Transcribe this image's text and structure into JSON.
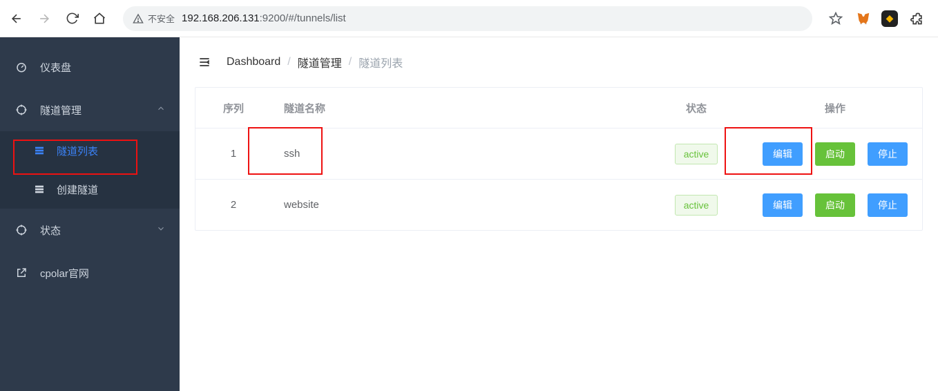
{
  "browser": {
    "insecure_label": "不安全",
    "url_host": "192.168.206.131",
    "url_port_path": ":9200/#/tunnels/list"
  },
  "sidebar": {
    "dashboard": "仪表盘",
    "tunnel_mgmt": "隧道管理",
    "tunnel_list": "隧道列表",
    "tunnel_create": "创建隧道",
    "status": "状态",
    "cpolar_site": "cpolar官网"
  },
  "breadcrumb": {
    "dashboard": "Dashboard",
    "tunnel_mgmt": "隧道管理",
    "tunnel_list": "隧道列表"
  },
  "table": {
    "headers": {
      "index": "序列",
      "name": "隧道名称",
      "status": "状态",
      "actions": "操作"
    },
    "action_labels": {
      "edit": "编辑",
      "start": "启动",
      "stop": "停止"
    },
    "rows": [
      {
        "index": "1",
        "name": "ssh",
        "status": "active"
      },
      {
        "index": "2",
        "name": "website",
        "status": "active"
      }
    ]
  }
}
